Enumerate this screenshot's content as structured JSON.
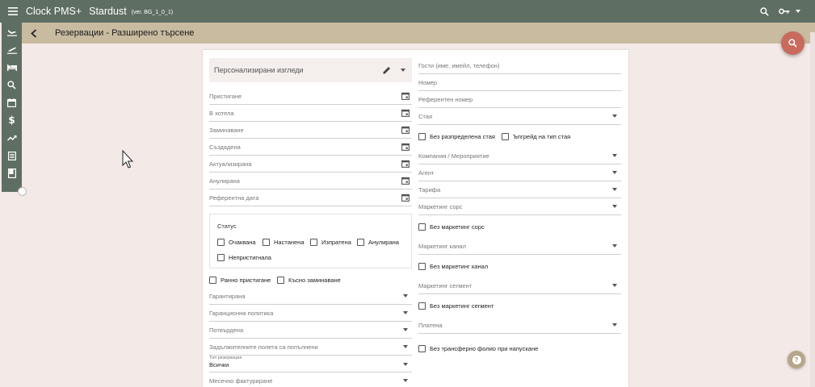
{
  "topbar": {
    "app_name": "Clock PMS+",
    "hotel_name": "Stardust",
    "version": "(ver. BG_1_0_1)"
  },
  "subbar": {
    "title": "Резервации - Разширено търсене"
  },
  "sidebar": {
    "items": [
      "arrivals-icon",
      "departures-icon",
      "bed-icon",
      "search-icon",
      "calendar-icon",
      "dollar-icon",
      "trend-icon",
      "report-icon",
      "book-icon"
    ]
  },
  "views": {
    "label": "Персонализирани изгледи"
  },
  "left_dates": [
    "Пристигане",
    "В хотела",
    "Заминаване",
    "Създадена",
    "Актуализирана",
    "Анулирана",
    "Референтна дата"
  ],
  "status": {
    "label": "Статус",
    "options": [
      "Очаквана",
      "Настанена",
      "Изпратена",
      "Анулирана",
      "Непристигнала"
    ]
  },
  "early_late": [
    "Ранно пристигане",
    "Късно заминаване"
  ],
  "left_selects": [
    "Гарантирана",
    "Гаранционна политика",
    "Потвърдена",
    "Задължителните полета са попълнени"
  ],
  "res_type": {
    "label": "Тип резервация",
    "value": "Всички"
  },
  "monthly_billing": "Месечно фактуриране",
  "right": {
    "guests": "Гости (име, имейл, телефон)",
    "number": "Номер",
    "ref_number": "Референтен номер",
    "room": "Стая",
    "no_room": "Без разпределена стая",
    "upgrade": "Ъпгрейд на тип стая",
    "company": "Компания / Мероприятие",
    "agent": "Агент",
    "rate": "Тарифа",
    "mkt_source": "Маркетинг сорс",
    "no_mkt_source": "Без маркетинг сорс",
    "mkt_channel": "Маркетинг канал",
    "no_mkt_channel": "Без маркетинг канал",
    "mkt_segment": "Маркетинг сегмент",
    "no_mkt_segment": "Без маркетинг сегмент",
    "paid": "Платена",
    "no_transfer": "Без трансферно фолио при напускане"
  }
}
